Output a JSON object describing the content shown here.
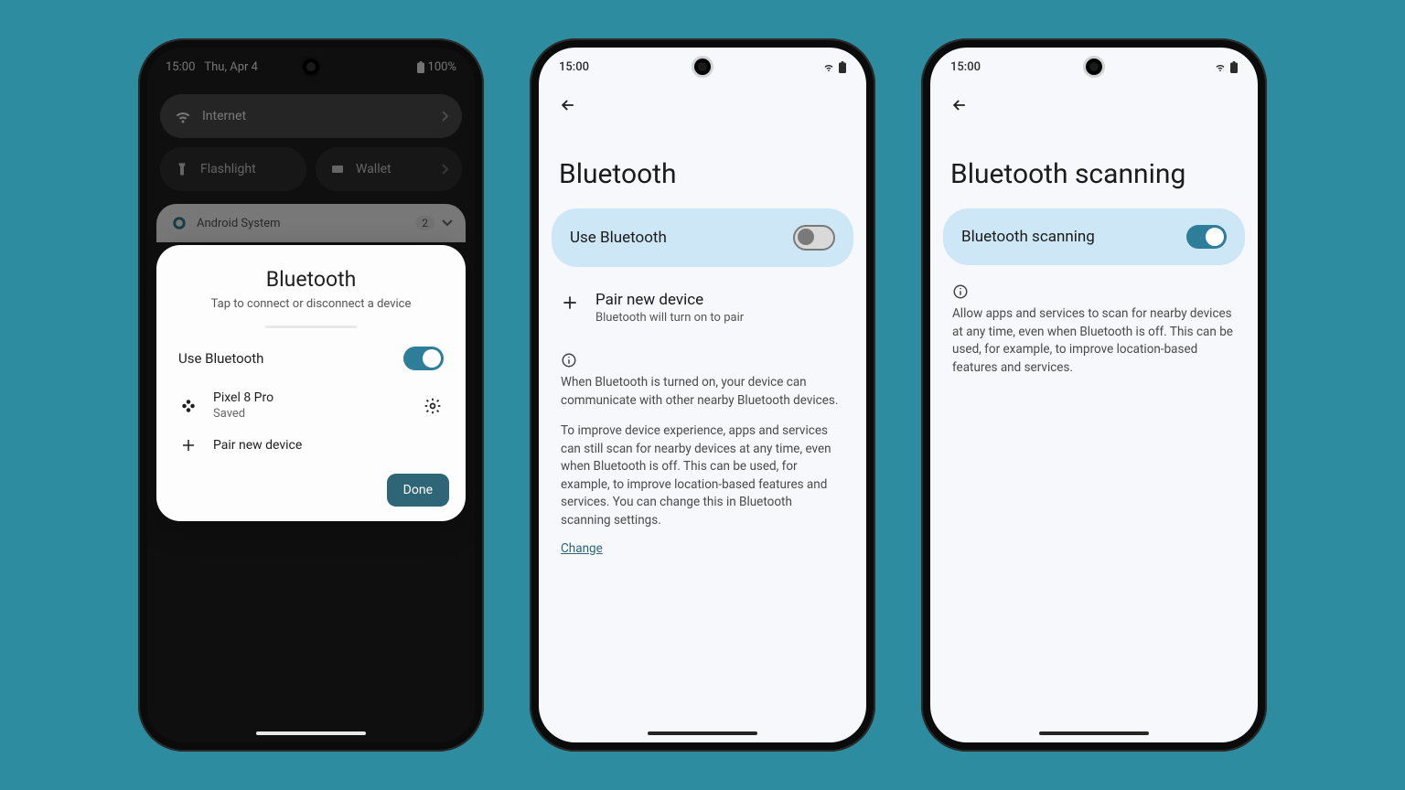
{
  "phone1": {
    "status": {
      "time": "15:00",
      "date": "Thu, Apr 4",
      "battery": "100%"
    },
    "qs": {
      "internet": "Internet",
      "flashlight": "Flashlight",
      "wallet": "Wallet"
    },
    "notif": {
      "app": "Android System",
      "count": "2"
    },
    "sheet": {
      "title": "Bluetooth",
      "subtitle": "Tap to connect or disconnect a device",
      "use_bt": "Use Bluetooth",
      "device_name": "Pixel 8 Pro",
      "device_status": "Saved",
      "pair": "Pair new device",
      "done": "Done"
    }
  },
  "phone2": {
    "status": {
      "time": "15:00"
    },
    "title": "Bluetooth",
    "card_label": "Use Bluetooth",
    "pair_title": "Pair new device",
    "pair_sub": "Bluetooth will turn on to pair",
    "info1": "When Bluetooth is turned on, your device can communicate with other nearby Bluetooth devices.",
    "info2": "To improve device experience, apps and services can still scan for nearby devices at any time, even when Bluetooth is off. This can be used, for example, to improve location-based features and services. You can change this in Bluetooth scanning settings.",
    "change": "Change"
  },
  "phone3": {
    "status": {
      "time": "15:00"
    },
    "title": "Bluetooth scanning",
    "card_label": "Bluetooth scanning",
    "info": "Allow apps and services to scan for nearby devices at any time, even when Bluetooth is off. This can be used, for example, to improve location-based features and services."
  }
}
